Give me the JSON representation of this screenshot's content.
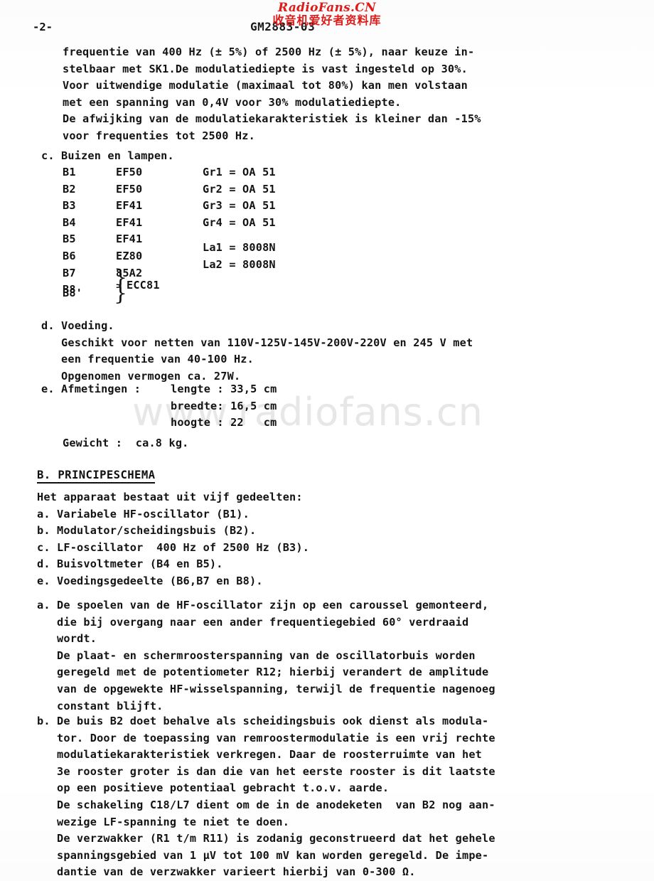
{
  "document": {
    "page_number_marker": "-2-",
    "document_id": "GM2883-03"
  },
  "watermarks": {
    "top_latin": "RadioFans.CN",
    "top_cjk": "收音机爱好者资料库",
    "center": "www.radiofans.cn",
    "red_color": "#e01b18",
    "gray_color": "#e7e7e7"
  },
  "content": {
    "intro_paragraph": "frequentie van 400 Hz (± 5%) of 2500 Hz (± 5%), naar keuze in-\nstelbaar met SK1.De modulatiediepte is vast ingesteld op 30%.\nVoor uitwendige modulatie (maximaal tot 80%) kan men volstaan\nmet een spanning van 0,4V voor 30% modulatiediepte.\nDe afwijking van de modulatiekarakteristiek is kleiner dan -15%\nvoor frequenties tot 2500 Hz.",
    "section_c": {
      "heading": "c. Buizen en lampen.",
      "tube_labels": "B1\nB2\nB3\nB4\nB5\nB6\nB7\nB8",
      "tube_types": "EF50\nEF50\nEF41\nEF41\nEF41\nEZ80\n85A2",
      "germanium": "Gr1 = OA 51\nGr2 = OA 51\nGr3 = OA 51\nGr4 = OA 51",
      "lamps": "La1 = 8008N\nLa2 = 8008N",
      "paired_label_2": "B8'",
      "paired_type": "ECC81"
    },
    "section_d": {
      "text": "d. Voeding.\n   Geschikt voor netten van 110V-125V-145V-200V-220V en 245 V met\n   een frequentie van 40-100 Hz.\n   Opgenomen vermogen ca. 27W."
    },
    "section_e": {
      "label": "e. Afmetingen :",
      "values": "lengte : 33,5 cm\nbreedte: 16,5 cm\nhoogte : 22   cm",
      "weight": "Gewicht :  ca.8 kg."
    },
    "section_B": {
      "heading_prefix": "B. ",
      "heading_title": "PRINCIPESCHEMA",
      "body": "Het apparaat bestaat uit vijf gedeelten:\na. Variabele HF-oscillator (B1).\nb. Modulator/scheidingsbuis (B2).\nc. LF-oscillator  400 Hz of 2500 Hz (B3).\nd. Buisvoltmeter (B4 en B5).\ne. Voedingsgedeelte (B6,B7 en B8).",
      "paragraph_a": "a. De spoelen van de HF-oscillator zijn op een caroussel gemonteerd,\n   die bij overgang naar een ander frequentiegebied 60° verdraaid\n   wordt.\n   De plaat- en schermroosterspanning van de oscillatorbuis worden\n   geregeld met de potentiometer R12; hierbij verandert de amplitude\n   van de opgewekte HF-wisselspanning, terwijl de frequentie nagenoeg\n   constant blijft.",
      "paragraph_b": "b. De buis B2 doet behalve als scheidingsbuis ook dienst als modula-\n   tor. Door de toepassing van remroostermodulatie is een vrij rechte\n   modulatiekarakteristiek verkregen. Daar de roosterruimte van het\n   3e rooster groter is dan die van het eerste rooster is dit laatste\n   op een positieve potentiaal gebracht t.o.v. aarde.\n   De schakeling C18/L7 dient om de in de anodeketen  van B2 nog aan-\n   wezige LF-spanning te niet te doen.\n   De verzwakker (R1 t/m R11) is zodanig geconstrueerd dat het gehele\n   spanningsgebied van 1 µV tot 100 mV kan worden geregeld. De impe-\n   dantie van de verzwakker varieert hierbij van 0-300 Ω."
    }
  }
}
